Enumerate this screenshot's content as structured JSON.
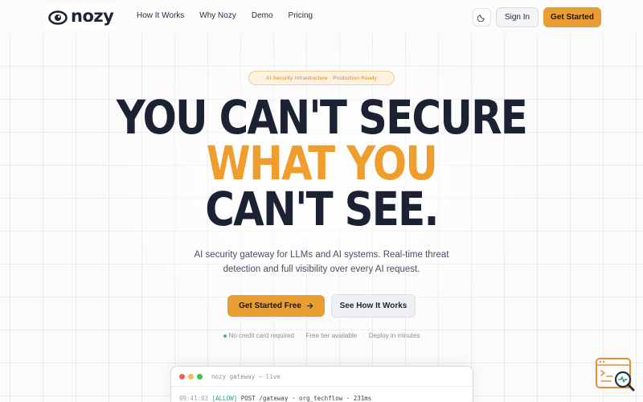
{
  "nav": {
    "brand": "nozy",
    "links": [
      "How It Works",
      "Why Nozy",
      "Demo",
      "Pricing"
    ],
    "theme_toggle_icon": "moon-icon",
    "sign_in": "Sign In",
    "get_started": "Get Started"
  },
  "hero": {
    "badge": "AI Security Infrastructure · Production Ready",
    "headline": [
      "YOU CAN'T SECURE",
      "WHAT YOU",
      "CAN'T SEE."
    ],
    "subtitle": [
      "AI security gateway for LLMs and AI systems. Real-time threat",
      "detection and full visibility over every AI request."
    ],
    "cta_primary": "Get Started Free",
    "cta_primary_icon": "arrow-right-icon",
    "cta_secondary": "See How It Works",
    "features": [
      "No credit card required",
      "Free tier available",
      "Deploy in minutes"
    ]
  },
  "terminal": {
    "title": "nozy gateway — live",
    "line": {
      "time": "09:41:03",
      "status": "[ALLOW]",
      "request": "POST /gateway · org_techflow · 231ms"
    }
  },
  "colors": {
    "accent": "#ea9d31",
    "headline_dark": "#1b2233",
    "headline_accent": "#ef9e2e",
    "allow_green": "#2fa96a",
    "dot_red": "#ee5f57",
    "dot_yellow": "#f4be4f",
    "dot_green": "#3fbf4e"
  },
  "widget": {
    "icon": "chat-search-icon"
  }
}
